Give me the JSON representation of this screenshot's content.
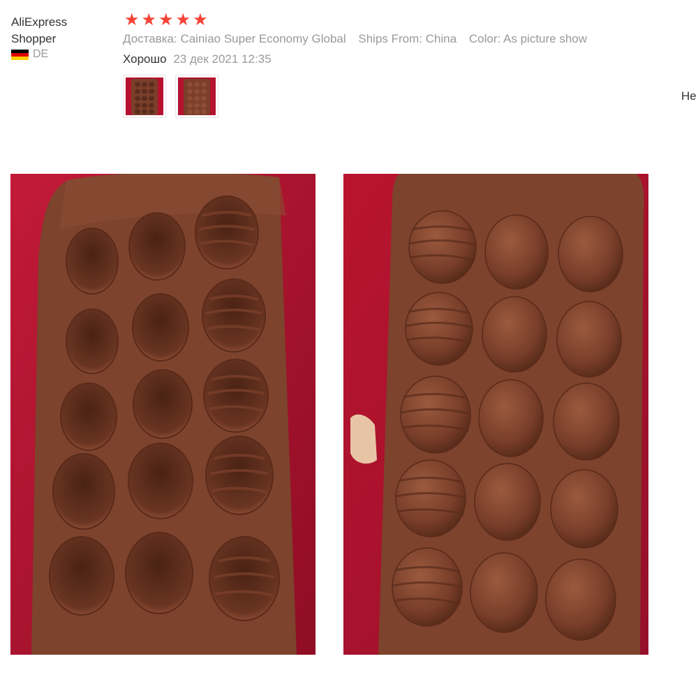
{
  "review": {
    "user_name": "AliExpress Shopper",
    "country_code": "DE",
    "rating": 5,
    "stars": [
      "★",
      "★",
      "★",
      "★",
      "★"
    ],
    "shipping": "Доставка: Cainiao Super Economy Global",
    "ships_from": "Ships From: China",
    "color": "Color: As picture show",
    "text": "Хорошо",
    "date": "23 дек 2021 12:35",
    "helpful_label": "Не",
    "thumbnails": [
      "review-photo-1-thumbnail",
      "review-photo-2-thumbnail"
    ],
    "photos": [
      "review-photo-1",
      "review-photo-2"
    ]
  },
  "colors": {
    "star": "#f44336",
    "muted_text": "#999999",
    "body_text": "#333333",
    "mold": "#7a3f2a",
    "background_fabric": "#b5122f"
  }
}
